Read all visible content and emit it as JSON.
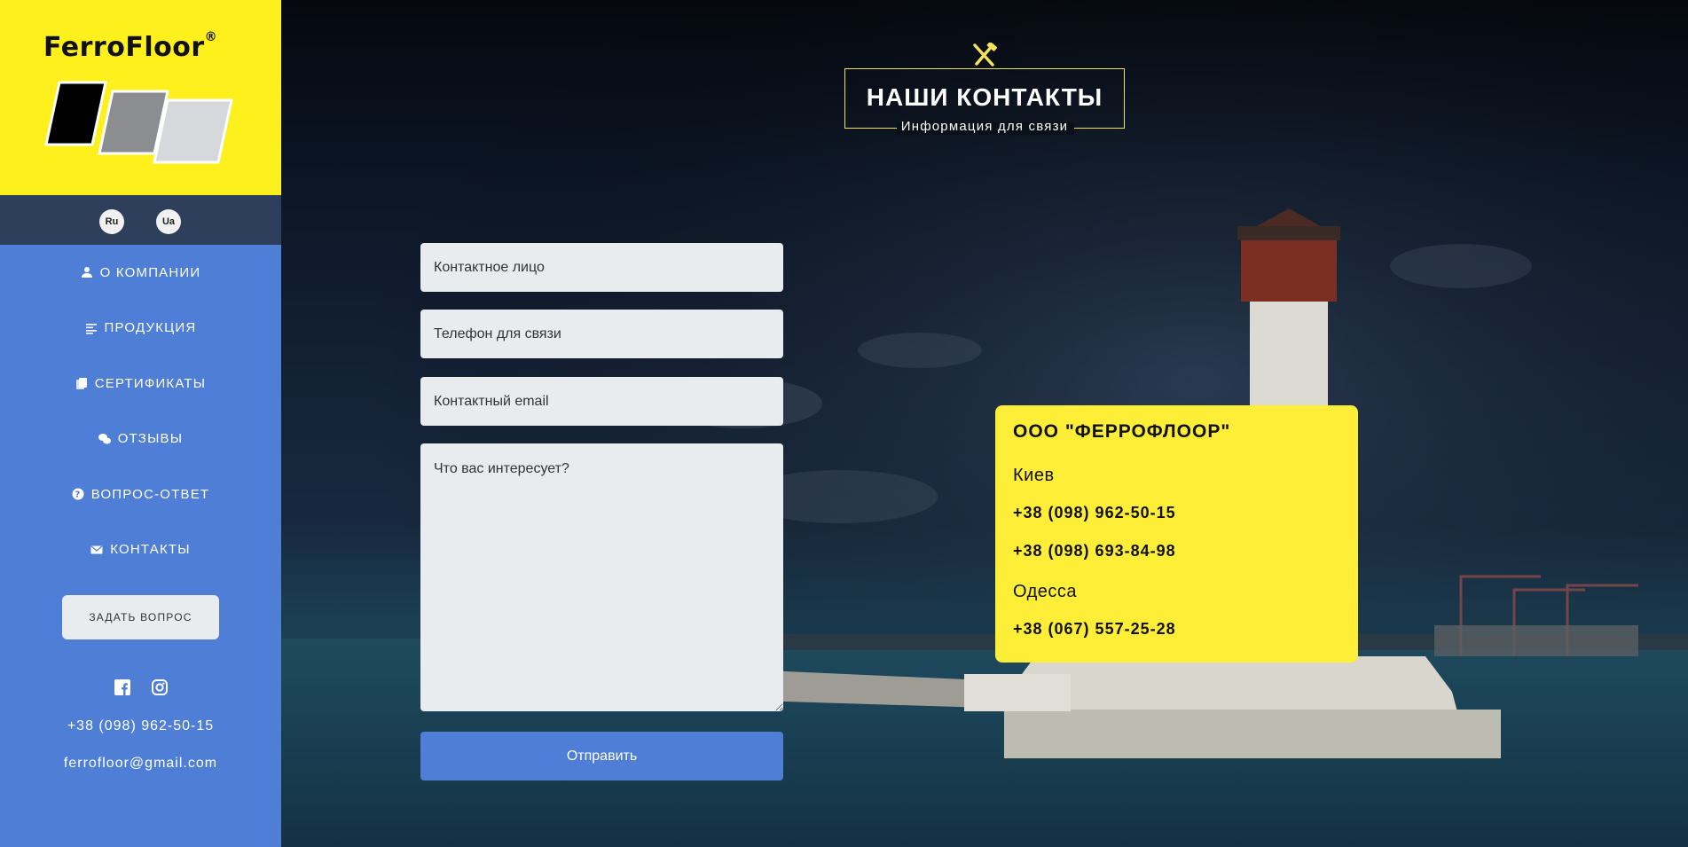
{
  "logo": {
    "brand": "FerroFloor",
    "mark": "®"
  },
  "languages": [
    "Ru",
    "Ua"
  ],
  "nav": {
    "items": [
      {
        "label": "О КОМПАНИИ",
        "icon": "user-icon"
      },
      {
        "label": "ПРОДУКЦИЯ",
        "icon": "list-icon"
      },
      {
        "label": "СЕРТИФИКАТЫ",
        "icon": "document-icon"
      },
      {
        "label": "ОТЗЫВЫ",
        "icon": "chat-icon"
      },
      {
        "label": "ВОПРОС-ОТВЕТ",
        "icon": "question-icon"
      },
      {
        "label": "КОНТАКТЫ",
        "icon": "mail-icon"
      }
    ]
  },
  "sidebar": {
    "ask_button": "ЗАДАТЬ ВОПРОС",
    "phone": "+38 (098) 962-50-15",
    "email": "ferrofloor@gmail.com"
  },
  "heading": {
    "title": "НАШИ КОНТАКТЫ",
    "subtitle": "Информация для связи"
  },
  "form": {
    "name_placeholder": "Контактное лицо",
    "phone_placeholder": "Телефон для связи",
    "email_placeholder": "Контактный email",
    "message_placeholder": "Что вас интересует?",
    "submit_label": "Отправить"
  },
  "contact_card": {
    "company": "ООО \"ФЕРРОФЛООР\"",
    "cities": [
      {
        "name": "Киев",
        "phones": [
          "+38 (098) 962-50-15",
          "+38 (098) 693-84-98"
        ]
      },
      {
        "name": "Одесса",
        "phones": [
          "+38 (067) 557-25-28"
        ]
      }
    ]
  },
  "colors": {
    "sidebar_blue": "#4f7ed6",
    "logo_yellow": "#fef01d",
    "card_yellow": "#feee37",
    "lang_bar": "#2e3f5c",
    "accent_gold": "#f2e25a"
  }
}
